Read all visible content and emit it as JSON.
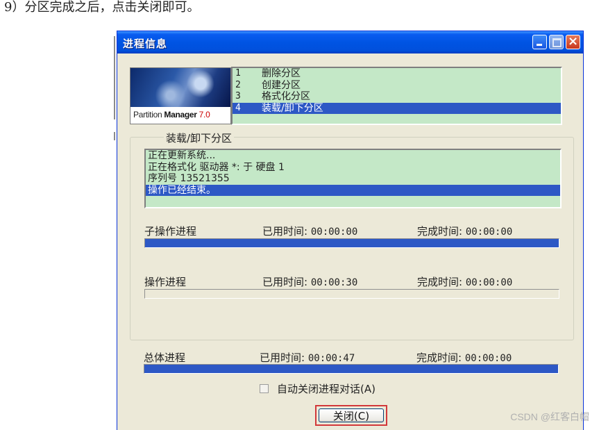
{
  "caption": "9）分区完成之后，点击关闭即可。",
  "watermark": "CSDN @红客白帽",
  "window": {
    "title": "进程信息",
    "buttons": {
      "minimize": "minimize-icon",
      "maximize": "maximize-icon",
      "close": "×"
    }
  },
  "logo": {
    "brand": "Partition",
    "product": "Manager",
    "version": "7.0"
  },
  "operations": [
    {
      "num": "1",
      "label": "删除分区",
      "selected": false
    },
    {
      "num": "2",
      "label": "创建分区",
      "selected": false
    },
    {
      "num": "3",
      "label": "格式化分区",
      "selected": false
    },
    {
      "num": "4",
      "label": "装载/卸下分区",
      "selected": true
    }
  ],
  "group_title": "装载/卸下分区",
  "status_lines": [
    {
      "text": "正在更新系统...",
      "selected": false
    },
    {
      "text": "正在格式化 驱动器 *: 于 硬盘 1",
      "selected": false
    },
    {
      "text": "序列号 13521355",
      "selected": false
    },
    {
      "text": "操作已经结束。",
      "selected": true
    }
  ],
  "progress": {
    "sub": {
      "label": "子操作进程",
      "elapsed_label": "已用时间:",
      "elapsed": "00:00:00",
      "done_label": "完成时间:",
      "done": "00:00:00",
      "percent": 100
    },
    "op": {
      "label": "操作进程",
      "elapsed_label": "已用时间:",
      "elapsed": "00:00:30",
      "done_label": "完成时间:",
      "done": "00:00:00",
      "percent": 0
    },
    "total": {
      "label": "总体进程",
      "elapsed_label": "已用时间:",
      "elapsed": "00:00:47",
      "done_label": "完成时间:",
      "done": "00:00:00",
      "percent": 100
    }
  },
  "auto_close": {
    "label": "自动关闭进程对话(A)",
    "checked": false
  },
  "close_button": "关闭(C)",
  "colors": {
    "accent": "#2d58c5",
    "list_bg": "#c4e8c7",
    "highlight_border": "#d2383a"
  }
}
